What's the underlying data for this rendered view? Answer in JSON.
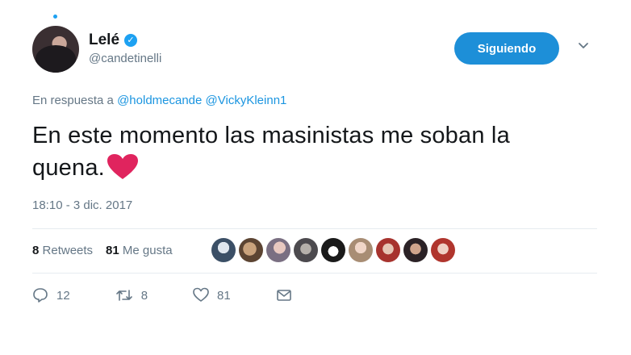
{
  "user": {
    "display_name": "Lelé",
    "handle": "@candetinelli",
    "verified_icon": "verified-badge-icon"
  },
  "header": {
    "follow_label": "Siguiendo",
    "menu_icon": "chevron-down-icon"
  },
  "reply": {
    "prefix": "En respuesta a",
    "mentions": [
      "@holdmecande",
      "@VickyKleinn1"
    ]
  },
  "tweet": {
    "text_line1": "En este momento las masinistas me soban la",
    "text_line2": "quena.",
    "emoji": "red-heart-icon",
    "timestamp": "18:10 - 3 dic. 2017"
  },
  "stats": {
    "retweets_count": "8",
    "retweets_label": "Retweets",
    "likes_count": "81",
    "likes_label": "Me gusta"
  },
  "likers": [
    "liker-avatar-1",
    "liker-avatar-2",
    "liker-avatar-3",
    "liker-avatar-4",
    "liker-avatar-5",
    "liker-avatar-6",
    "liker-avatar-7",
    "liker-avatar-8",
    "liker-avatar-9"
  ],
  "actions": {
    "reply_count": "12",
    "retweet_count": "8",
    "like_count": "81"
  },
  "colors": {
    "accent": "#1da1f2",
    "follow_button": "#1d8fd8",
    "heart": "#e0245e"
  }
}
